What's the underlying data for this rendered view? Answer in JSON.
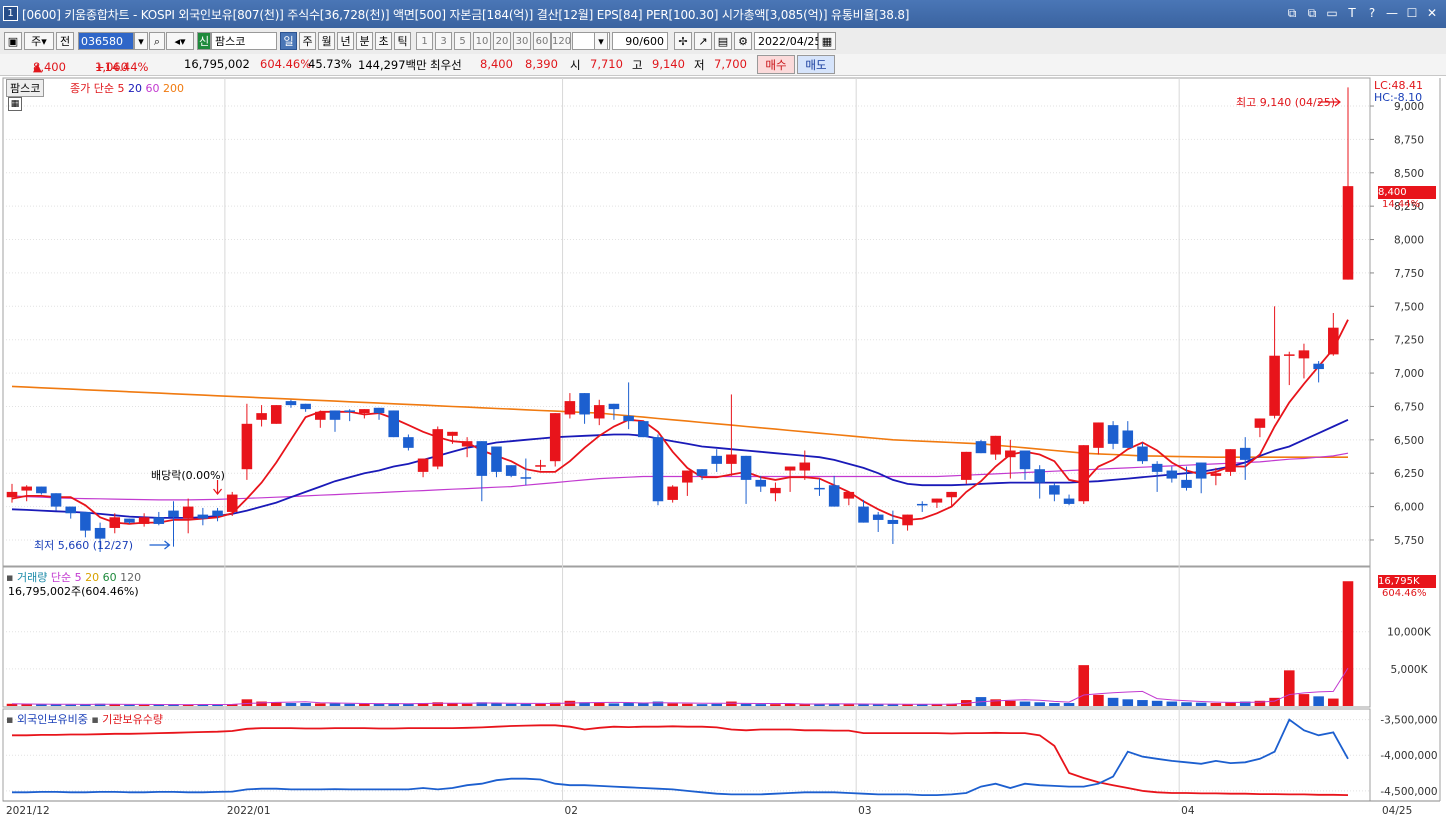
{
  "window": {
    "badge": "1",
    "title": "[0600] 키움종합차트 - KOSPI 외국인보유[807(천)] 주식수[36,728(천)] 액면[500] 자본금[184(억)] 결산[12월] EPS[84] PER[100.30] 시가총액[3,085(억)] 유통비율[38.8]",
    "controls": [
      "⧉",
      "⧉",
      "▭",
      "T",
      "?",
      "—",
      "☐",
      "✕"
    ]
  },
  "toolbar": {
    "period_select": "주",
    "prev_btn": "전",
    "code": "036580",
    "stock_tag": "신",
    "stock_name": "팜스코",
    "tabs": [
      "일",
      "주",
      "월",
      "년",
      "분",
      "초",
      "틱"
    ],
    "active_tab": "일",
    "intervals": [
      "1",
      "3",
      "5",
      "10",
      "20",
      "30",
      "60",
      "120"
    ],
    "count_value": "90",
    "count_total": "/600",
    "date": "2022/04/25"
  },
  "quote": {
    "price": "8,400",
    "change_arrow": "▲",
    "change": "1,060",
    "change_pct": "+14.44%",
    "volume": "16,795,002",
    "volume_ratio": "604.46%",
    "turnover": "45.73%",
    "amount": "144,297백만",
    "best_bid_label": "최우선",
    "ask": "8,400",
    "bid": "8,390",
    "open_label": "시",
    "open": "7,710",
    "high_label": "고",
    "high": "9,140",
    "low_label": "저",
    "low": "7,700",
    "buy_btn": "매수",
    "sell_btn": "매도"
  },
  "price_panel": {
    "stock_label": "팜스코",
    "legend": [
      "종가",
      "단순",
      "5",
      "20",
      "60",
      "200"
    ],
    "lc": "LC:48.41",
    "hc": "HC:-8.10",
    "y_ticks": [
      "9,000",
      "8,750",
      "8,500",
      "8,250",
      "8,000",
      "7,750",
      "7,500",
      "7,250",
      "7,000",
      "6,750",
      "6,500",
      "6,250",
      "6,000",
      "5,750"
    ],
    "last_price": "8,400",
    "last_pct": "14.44%",
    "max_note": "최고 9,140 (04/25)",
    "min_note": "최저 5,660 (12/27)",
    "dividend_note": "배당락(0.00%)"
  },
  "volume_panel": {
    "legend": [
      "거래량",
      "단순",
      "5",
      "20",
      "60",
      "120"
    ],
    "value_note": "16,795,002주(604.46%)",
    "y_ticks": [
      "10,000K",
      "5,000K"
    ],
    "last": "16,795K",
    "last_pct": "604.46%"
  },
  "foreign_panel": {
    "legend": [
      "외국인보유비중",
      "기관보유수량"
    ],
    "y_ticks": [
      "-3,500,000",
      "-4,000,000",
      "-4,500,000"
    ]
  },
  "x_axis": [
    "2021/12",
    "2022/01",
    "02",
    "03",
    "04"
  ],
  "x_end": "04/25",
  "colors": {
    "up": "#e8141b",
    "down": "#1c5fcf",
    "ma5": "#e8141b",
    "ma20": "#1a1ab8",
    "ma60": "#c23ad0",
    "ma200": "#f07a10"
  },
  "chart_data": {
    "type": "candlestick",
    "candles": [
      [
        6070,
        6170,
        6030,
        6110
      ],
      [
        6120,
        6160,
        6040,
        6150
      ],
      [
        6150,
        6130,
        6090,
        6100
      ],
      [
        6100,
        6100,
        5970,
        6000
      ],
      [
        6000,
        5990,
        5910,
        5950
      ],
      [
        5960,
        5960,
        5770,
        5820
      ],
      [
        5840,
        5880,
        5660,
        5760
      ],
      [
        5840,
        5950,
        5800,
        5920
      ],
      [
        5910,
        5910,
        5870,
        5880
      ],
      [
        5870,
        5950,
        5850,
        5920
      ],
      [
        5920,
        5960,
        5860,
        5870
      ],
      [
        5970,
        6040,
        5700,
        5920
      ],
      [
        5910,
        6060,
        5800,
        6000
      ],
      [
        5940,
        5990,
        5860,
        5910
      ],
      [
        5970,
        5990,
        5890,
        5930
      ],
      [
        5960,
        6110,
        5930,
        6090
      ],
      [
        6280,
        6770,
        6200,
        6620
      ],
      [
        6650,
        6760,
        6600,
        6700
      ],
      [
        6620,
        6710,
        6630,
        6760
      ],
      [
        6790,
        6800,
        6740,
        6760
      ],
      [
        6770,
        6770,
        6710,
        6730
      ],
      [
        6650,
        6720,
        6590,
        6710
      ],
      [
        6720,
        6720,
        6560,
        6650
      ],
      [
        6720,
        6730,
        6640,
        6710
      ],
      [
        6700,
        6720,
        6660,
        6730
      ],
      [
        6740,
        6740,
        6650,
        6700
      ],
      [
        6720,
        6720,
        6550,
        6520
      ],
      [
        6520,
        6540,
        6420,
        6440
      ],
      [
        6260,
        6350,
        6220,
        6360
      ],
      [
        6300,
        6600,
        6280,
        6580
      ],
      [
        6530,
        6530,
        6470,
        6560
      ],
      [
        6450,
        6520,
        6370,
        6490
      ],
      [
        6490,
        6490,
        6040,
        6230
      ],
      [
        6450,
        6450,
        6220,
        6260
      ],
      [
        6310,
        6310,
        6220,
        6230
      ],
      [
        6220,
        6360,
        6160,
        6210
      ],
      [
        6300,
        6350,
        6270,
        6310
      ],
      [
        6340,
        6620,
        6300,
        6700
      ],
      [
        6690,
        6850,
        6660,
        6790
      ],
      [
        6850,
        6850,
        6620,
        6690
      ],
      [
        6660,
        6800,
        6610,
        6760
      ],
      [
        6770,
        6770,
        6650,
        6730
      ],
      [
        6680,
        6930,
        6580,
        6640
      ],
      [
        6640,
        6580,
        6620,
        6520
      ],
      [
        6520,
        6540,
        6010,
        6040
      ],
      [
        6050,
        6160,
        6030,
        6150
      ],
      [
        6180,
        6200,
        6080,
        6270
      ],
      [
        6280,
        6180,
        6200,
        6230
      ],
      [
        6380,
        6430,
        6260,
        6320
      ],
      [
        6320,
        6840,
        6230,
        6390
      ],
      [
        6380,
        6380,
        6020,
        6200
      ],
      [
        6200,
        6230,
        6110,
        6150
      ],
      [
        6100,
        6180,
        6040,
        6140
      ],
      [
        6270,
        6270,
        6110,
        6300
      ],
      [
        6270,
        6420,
        6200,
        6330
      ],
      [
        6140,
        6210,
        6080,
        6130
      ],
      [
        6160,
        6230,
        6020,
        6000
      ],
      [
        6060,
        6100,
        6010,
        6110
      ],
      [
        6000,
        6050,
        5960,
        5880
      ],
      [
        5940,
        5960,
        5810,
        5900
      ],
      [
        5900,
        5970,
        5720,
        5870
      ],
      [
        5860,
        5940,
        5820,
        5940
      ],
      [
        6020,
        6040,
        5960,
        6010
      ],
      [
        6030,
        6060,
        5990,
        6060
      ],
      [
        6070,
        6070,
        6000,
        6110
      ],
      [
        6200,
        6200,
        6170,
        6410
      ],
      [
        6490,
        6500,
        6560,
        6400
      ],
      [
        6390,
        6400,
        6350,
        6530
      ],
      [
        6370,
        6500,
        6210,
        6420
      ],
      [
        6420,
        6380,
        6200,
        6280
      ],
      [
        6280,
        6310,
        6060,
        6180
      ],
      [
        6160,
        6180,
        6040,
        6090
      ],
      [
        6060,
        6090,
        6010,
        6020
      ],
      [
        6040,
        6060,
        6020,
        6460
      ],
      [
        6440,
        6490,
        6390,
        6630
      ],
      [
        6610,
        6640,
        6430,
        6470
      ],
      [
        6570,
        6640,
        6450,
        6440
      ],
      [
        6450,
        6480,
        6320,
        6340
      ],
      [
        6320,
        6340,
        6110,
        6260
      ],
      [
        6270,
        6300,
        6180,
        6210
      ],
      [
        6200,
        6300,
        6120,
        6140
      ],
      [
        6330,
        6330,
        6100,
        6210
      ],
      [
        6230,
        6290,
        6160,
        6250
      ],
      [
        6260,
        6330,
        6230,
        6430
      ],
      [
        6440,
        6520,
        6200,
        6350
      ],
      [
        6590,
        6600,
        6520,
        6660
      ],
      [
        6680,
        7500,
        6660,
        7130
      ],
      [
        7140,
        7160,
        6910,
        7140
      ],
      [
        7110,
        7220,
        6960,
        7170
      ],
      [
        7070,
        7090,
        6930,
        7030
      ],
      [
        7140,
        7450,
        7130,
        7340
      ],
      [
        7700,
        9140,
        7700,
        8400
      ]
    ],
    "ma5": [
      6060,
      6080,
      6080,
      6070,
      6070,
      6010,
      5920,
      5880,
      5870,
      5880,
      5880,
      5900,
      5900,
      5910,
      5920,
      5950,
      6060,
      6180,
      6330,
      6500,
      6670,
      6710,
      6710,
      6710,
      6690,
      6700,
      6660,
      6610,
      6560,
      6520,
      6490,
      6480,
      6420,
      6380,
      6340,
      6280,
      6260,
      6260,
      6340,
      6440,
      6530,
      6600,
      6650,
      6640,
      6560,
      6410,
      6290,
      6220,
      6220,
      6240,
      6260,
      6220,
      6200,
      6220,
      6220,
      6210,
      6160,
      6110,
      6040,
      5980,
      5930,
      5900,
      5910,
      5950,
      6000,
      6110,
      6190,
      6300,
      6390,
      6410,
      6390,
      6340,
      6200,
      6180,
      6300,
      6350,
      6430,
      6480,
      6420,
      6330,
      6270,
      6240,
      6260,
      6300,
      6300,
      6390,
      6600,
      6780,
      6920,
      7050,
      7180,
      7400
    ],
    "ma20": [
      5980,
      5975,
      5970,
      5965,
      5960,
      5955,
      5945,
      5935,
      5925,
      5920,
      5915,
      5915,
      5915,
      5920,
      5930,
      5945,
      5970,
      6000,
      6030,
      6070,
      6110,
      6150,
      6190,
      6220,
      6250,
      6270,
      6300,
      6320,
      6350,
      6380,
      6410,
      6440,
      6460,
      6480,
      6490,
      6500,
      6510,
      6520,
      6525,
      6530,
      6535,
      6540,
      6540,
      6530,
      6510,
      6490,
      6470,
      6450,
      6440,
      6430,
      6420,
      6410,
      6400,
      6390,
      6380,
      6370,
      6350,
      6320,
      6290,
      6250,
      6200,
      6170,
      6160,
      6160,
      6160,
      6165,
      6170,
      6175,
      6180,
      6180,
      6180,
      6180,
      6180,
      6185,
      6190,
      6200,
      6210,
      6220,
      6230,
      6240,
      6250,
      6260,
      6280,
      6300,
      6330,
      6380,
      6420,
      6450,
      6500,
      6550,
      6600,
      6650
    ],
    "ma60": [
      6080,
      6075,
      6070,
      6065,
      6062,
      6060,
      6058,
      6056,
      6054,
      6052,
      6050,
      6050,
      6050,
      6052,
      6054,
      6058,
      6062,
      6066,
      6070,
      6075,
      6080,
      6085,
      6090,
      6095,
      6100,
      6105,
      6110,
      6115,
      6120,
      6125,
      6130,
      6135,
      6140,
      6145,
      6150,
      6160,
      6170,
      6180,
      6190,
      6200,
      6210,
      6215,
      6220,
      6225,
      6225,
      6225,
      6225,
      6225,
      6225,
      6225,
      6225,
      6225,
      6225,
      6225,
      6225,
      6225,
      6225,
      6225,
      6225,
      6225,
      6225,
      6225,
      6225,
      6225,
      6230,
      6235,
      6240,
      6245,
      6250,
      6255,
      6260,
      6265,
      6270,
      6275,
      6280,
      6285,
      6290,
      6295,
      6300,
      6305,
      6310,
      6315,
      6320,
      6325,
      6330,
      6335,
      6345,
      6355,
      6360,
      6370,
      6380,
      6400
    ],
    "ma200": [
      6900,
      6895,
      6890,
      6885,
      6880,
      6875,
      6870,
      6865,
      6860,
      6855,
      6850,
      6845,
      6840,
      6835,
      6830,
      6825,
      6820,
      6815,
      6810,
      6805,
      6800,
      6795,
      6790,
      6785,
      6780,
      6775,
      6770,
      6765,
      6760,
      6755,
      6750,
      6745,
      6740,
      6735,
      6730,
      6725,
      6720,
      6715,
      6710,
      6705,
      6700,
      6690,
      6680,
      6670,
      6660,
      6650,
      6640,
      6630,
      6620,
      6610,
      6600,
      6590,
      6580,
      6570,
      6560,
      6550,
      6540,
      6530,
      6520,
      6510,
      6500,
      6495,
      6490,
      6485,
      6480,
      6475,
      6470,
      6460,
      6450,
      6440,
      6430,
      6420,
      6410,
      6400,
      6395,
      6390,
      6385,
      6380,
      6378,
      6376,
      6374,
      6372,
      6370,
      6370,
      6370,
      6370,
      6370,
      6370,
      6370,
      6370,
      6370,
      6370
    ],
    "volume": [
      300,
      250,
      200,
      220,
      180,
      250,
      300,
      200,
      180,
      150,
      180,
      250,
      200,
      200,
      150,
      250,
      900,
      600,
      500,
      400,
      400,
      350,
      350,
      300,
      300,
      300,
      350,
      300,
      400,
      500,
      350,
      300,
      500,
      350,
      300,
      300,
      300,
      450,
      700,
      500,
      400,
      350,
      400,
      400,
      600,
      350,
      300,
      250,
      300,
      600,
      300,
      250,
      250,
      300,
      250,
      300,
      300,
      250,
      250,
      200,
      250,
      200,
      250,
      250,
      300,
      800,
      1200,
      900,
      700,
      600,
      500,
      400,
      400,
      5500,
      1500,
      1100,
      900,
      800,
      700,
      600,
      500,
      450,
      400,
      500,
      600,
      700,
      1100,
      4800,
      1600,
      1300,
      1000,
      16795
    ],
    "foreign": [
      -3720,
      -3720,
      -3715,
      -3715,
      -3710,
      -3710,
      -3705,
      -3700,
      -3700,
      -3695,
      -3690,
      -3685,
      -3680,
      -3675,
      -3670,
      -3660,
      -3630,
      -3620,
      -3620,
      -3620,
      -3625,
      -3625,
      -3620,
      -3620,
      -3620,
      -3625,
      -3625,
      -3620,
      -3620,
      -3620,
      -3620,
      -3615,
      -3610,
      -3600,
      -3590,
      -3585,
      -3580,
      -3580,
      -3600,
      -3640,
      -3615,
      -3600,
      -3605,
      -3600,
      -3600,
      -3595,
      -3600,
      -3600,
      -3610,
      -3640,
      -3650,
      -3640,
      -3640,
      -3640,
      -3650,
      -3650,
      -3655,
      -3655,
      -3690,
      -3690,
      -3690,
      -3690,
      -3690,
      -3690,
      -3695,
      -3690,
      -3690,
      -3685,
      -3690,
      -3690,
      -3720,
      -3870,
      -4250,
      -4320,
      -4380,
      -4420,
      -4460,
      -4500,
      -4520,
      -4530,
      -4530,
      -4535,
      -4535,
      -4540,
      -4540,
      -4545,
      -4545,
      -4550,
      -4550,
      -4555,
      -4555,
      -4560
    ],
    "institution": [
      -4520,
      -4520,
      -4515,
      -4515,
      -4520,
      -4520,
      -4515,
      -4515,
      -4520,
      -4520,
      -4515,
      -4515,
      -4520,
      -4520,
      -4515,
      -4510,
      -4480,
      -4470,
      -4470,
      -4480,
      -4480,
      -4480,
      -4475,
      -4480,
      -4480,
      -4480,
      -4480,
      -4480,
      -4460,
      -4480,
      -4460,
      -4420,
      -4400,
      -4350,
      -4330,
      -4330,
      -4340,
      -4400,
      -4420,
      -4420,
      -4430,
      -4440,
      -4450,
      -4460,
      -4470,
      -4480,
      -4500,
      -4520,
      -4540,
      -4550,
      -4550,
      -4550,
      -4540,
      -4530,
      -4520,
      -4520,
      -4520,
      -4530,
      -4540,
      -4550,
      -4550,
      -4550,
      -4560,
      -4560,
      -4550,
      -4530,
      -4440,
      -4400,
      -4460,
      -4400,
      -4420,
      -4430,
      -4440,
      -4440,
      -4400,
      -4300,
      -3950,
      -4020,
      -4050,
      -4080,
      -4100,
      -4120,
      -4080,
      -4110,
      -4100,
      -4050,
      -3950,
      -3500,
      -3650,
      -3720,
      -3680,
      -4050
    ]
  }
}
